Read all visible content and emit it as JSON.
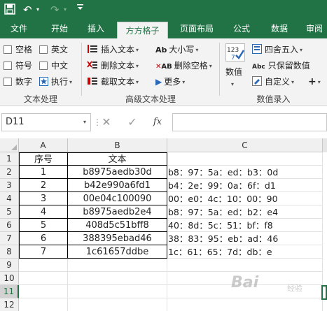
{
  "quick_access": {
    "save_icon": "save-icon",
    "undo": "↶",
    "redo": "↷",
    "dropdown": "▾"
  },
  "tabs": [
    {
      "label": "文件"
    },
    {
      "label": "开始"
    },
    {
      "label": "插入"
    },
    {
      "label": "方方格子",
      "active": true
    },
    {
      "label": "页面布局"
    },
    {
      "label": "公式"
    },
    {
      "label": "数据"
    },
    {
      "label": "审阅"
    }
  ],
  "ribbon": {
    "text_processing": {
      "label": "文本处理",
      "checkboxes": [
        "空格",
        "英文",
        "符号",
        "中文",
        "数字"
      ],
      "execute": "执行"
    },
    "advanced_text": {
      "label": "高级文本处理",
      "insert_text": "插入文本",
      "delete_text": "删除文本",
      "extract_text": "截取文本",
      "case": "大小写",
      "delete_space": "删除空格",
      "more": "更多"
    },
    "numeric_entry": {
      "label": "数值录入",
      "numeric": "数值",
      "round": "四舍五入",
      "keep_numeric": "只保留数值",
      "custom": "自定义"
    }
  },
  "formula_bar": {
    "name_box": "D11",
    "cancel": "✕",
    "confirm": "✓",
    "fx": "fx",
    "value": ""
  },
  "grid": {
    "columns": [
      "A",
      "B",
      "C"
    ],
    "rows": [
      "1",
      "2",
      "3",
      "4",
      "5",
      "6",
      "7",
      "8",
      "9",
      "10",
      "11",
      "12"
    ],
    "selected_row": "11",
    "headers": {
      "A": "序号",
      "B": "文本"
    },
    "data": [
      {
        "a": "1",
        "b": "b8975aedb30d",
        "c": "b8：97：5a：ed：b3：0d"
      },
      {
        "a": "2",
        "b": "b42e990a6fd1",
        "c": "b4：2e：99：0a：6f：d1"
      },
      {
        "a": "3",
        "b": "00e04c100090",
        "c": "00：e0：4c：10：00：90"
      },
      {
        "a": "4",
        "b": "b8975aedb2e4",
        "c": "b8：97：5a：ed：b2：e4"
      },
      {
        "a": "5",
        "b": "408d5c51bff8",
        "c": "40：8d：5c：51：bf：f8"
      },
      {
        "a": "6",
        "b": "388395ebad46",
        "c": "38：83：95：eb：ad：46"
      },
      {
        "a": "7",
        "b": "1c61657ddbe",
        "c": "1c：61：65：7d：db：e"
      }
    ]
  },
  "watermark": {
    "text": "Bai",
    "sub": "经验"
  }
}
